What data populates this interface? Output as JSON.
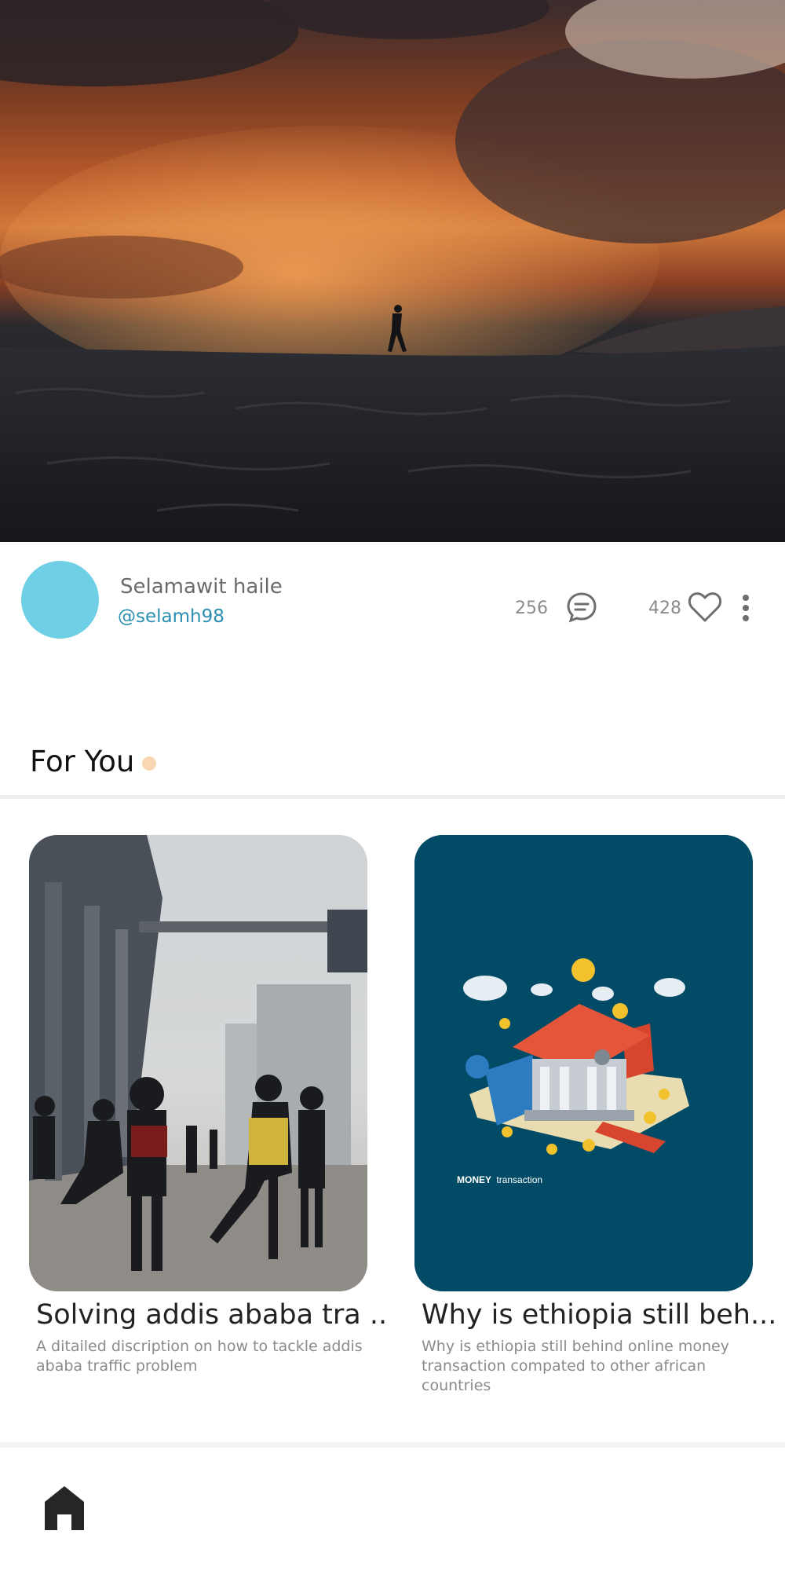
{
  "hero": {
    "image": "sunset-volcano-silhouette"
  },
  "profile": {
    "name": "Selamawit haile",
    "handle": "@selamh98",
    "comment_count": "256",
    "like_count": "428",
    "avatar_color": "#6fcfe5"
  },
  "section": {
    "title": "For You",
    "accent_dot_color": "#fad7b3"
  },
  "cards": [
    {
      "image": "street-football-photo",
      "title": "Solving addis ababa tra ..",
      "description": "A ditailed discription on how to tackle addis ababa traffic problem"
    },
    {
      "image": "money-transaction-illustration",
      "image_caption_bold": "MONEY",
      "image_caption": "transaction",
      "title": "Why is ethiopia still beh...",
      "description": "Why is ethiopia still behind online money transaction compated to other african countries"
    }
  ],
  "nav": {
    "home_icon": "home-icon"
  }
}
